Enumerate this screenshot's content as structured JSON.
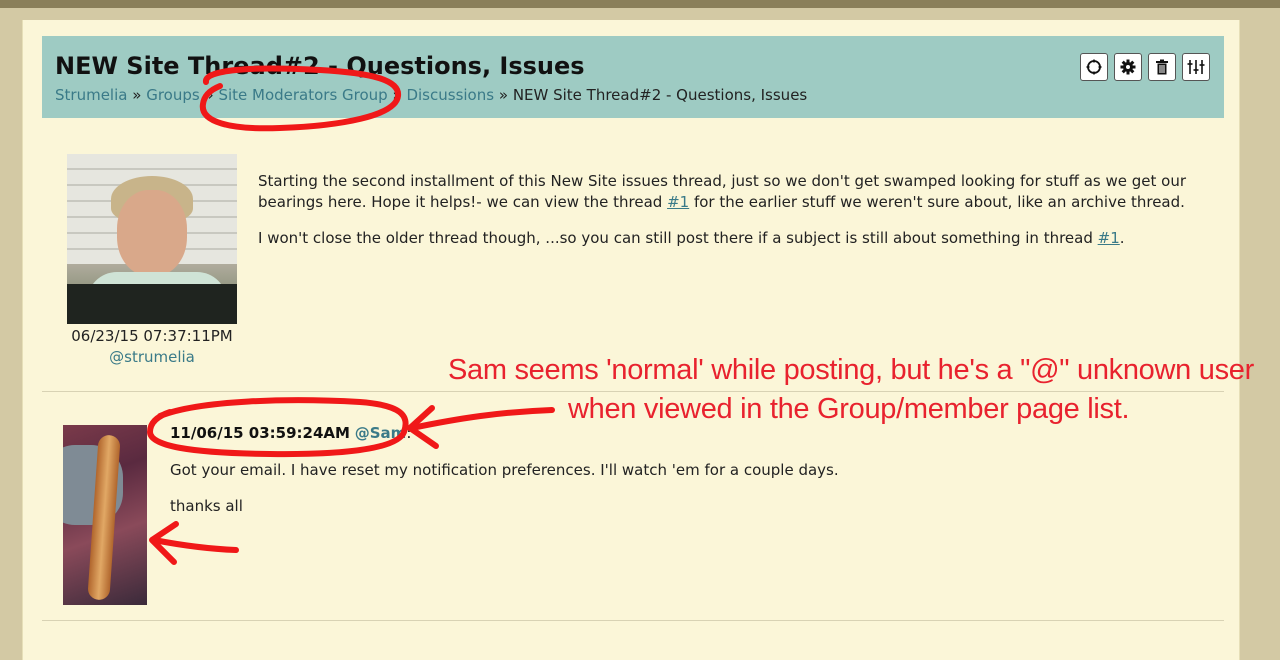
{
  "thread": {
    "title": "NEW Site Thread#2 - Questions, Issues",
    "breadcrumbs": [
      {
        "label": "Strumelia",
        "link": true
      },
      {
        "label": "Groups",
        "link": true
      },
      {
        "label": "Site Moderators Group",
        "link": true
      },
      {
        "label": "Discussions",
        "link": true
      },
      {
        "label": "NEW Site Thread#2 - Questions, Issues",
        "link": false
      }
    ],
    "separator": "»"
  },
  "toolbar": {
    "icons": [
      "crosshair-icon",
      "gear-icon",
      "trash-icon",
      "sliders-icon"
    ]
  },
  "posts": [
    {
      "date": "06/23/15 07:37:11PM",
      "user": "@strumelia",
      "paragraphs": [
        {
          "before": "Starting the second installment of this New Site issues thread, just so we don't get swamped looking for stuff as we get our bearings here.  Hope it helps!- we can view the thread ",
          "link": "#1",
          "after": " for the earlier stuff we weren't sure about, like an archive thread."
        },
        {
          "before": "I won't close the older thread though, ...so you can still post there if a subject is still about something in thread ",
          "link": "#1",
          "after": "."
        }
      ]
    },
    {
      "date": "11/06/15 03:59:24AM",
      "user": "@Sam",
      "user_suffix": ":",
      "paragraphs": [
        {
          "text": "Got your email. I have reset my notification preferences. I'll watch 'em for a couple days."
        },
        {
          "text": "thanks all"
        }
      ]
    }
  ],
  "annotation": {
    "line1": "Sam seems 'normal' while posting, but he's a \"@\" unknown user",
    "line2": "when viewed in the Group/member page list.",
    "color": "#e8222e"
  },
  "colors": {
    "header_bg": "#9ecbc3",
    "page_bg": "#fbf6d8",
    "link": "#3a7a88"
  }
}
